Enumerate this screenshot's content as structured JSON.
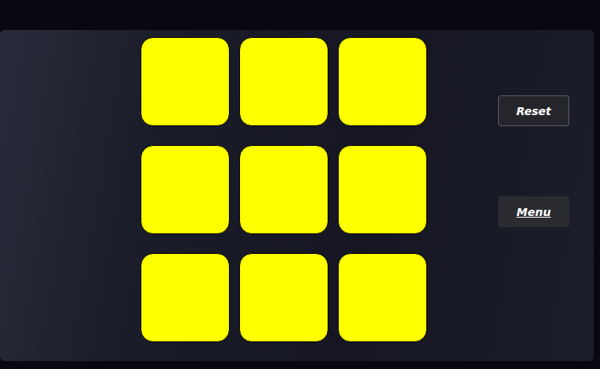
{
  "board": {
    "tiles": [
      {
        "revealed": false
      },
      {
        "revealed": false
      },
      {
        "revealed": false
      },
      {
        "revealed": false
      },
      {
        "revealed": false
      },
      {
        "revealed": false
      },
      {
        "revealed": false
      },
      {
        "revealed": false
      },
      {
        "revealed": false
      }
    ]
  },
  "buttons": [
    {
      "label": "Reset",
      "kind": "outlined"
    },
    {
      "label": "Menu",
      "kind": "link"
    }
  ]
}
